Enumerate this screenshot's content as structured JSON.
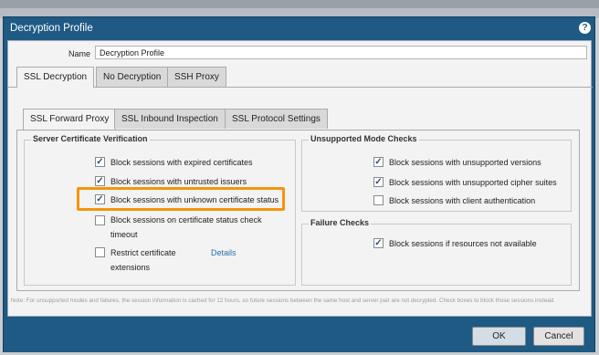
{
  "dialog": {
    "title": "Decryption Profile",
    "help_icon": "question-circle-icon"
  },
  "name": {
    "label": "Name",
    "value": "Decryption Profile"
  },
  "tabs": [
    {
      "label": "SSL Decryption",
      "active": true
    },
    {
      "label": "No Decryption",
      "active": false
    },
    {
      "label": "SSH Proxy",
      "active": false
    }
  ],
  "subtabs": [
    {
      "label": "SSL Forward Proxy",
      "active": true
    },
    {
      "label": "SSL Inbound Inspection",
      "active": false
    },
    {
      "label": "SSL Protocol Settings",
      "active": false
    }
  ],
  "server_cert": {
    "title": "Server Certificate Verification",
    "items": [
      {
        "label": "Block sessions with expired certificates",
        "checked": true
      },
      {
        "label": "Block sessions with untrusted issuers",
        "checked": true
      },
      {
        "label": "Block sessions with unknown certificate status",
        "checked": true
      },
      {
        "label": "Block sessions on certificate status check",
        "label2": "timeout",
        "checked": false
      },
      {
        "label": "Restrict certificate",
        "label2": "extensions",
        "checked": false
      }
    ],
    "details_link": "Details"
  },
  "unsupported": {
    "title": "Unsupported Mode Checks",
    "items": [
      {
        "label": "Block sessions with unsupported versions",
        "checked": true
      },
      {
        "label": "Block sessions with unsupported cipher suites",
        "checked": true
      },
      {
        "label": "Block sessions with client authentication",
        "checked": false
      }
    ]
  },
  "failure": {
    "title": "Failure Checks",
    "items": [
      {
        "label": "Block sessions if resources not available",
        "checked": true
      }
    ]
  },
  "note": "Note: For unsupported modes and failures, the session information is cached for 12 hours, so future sessions between the same host and server pair are not decrypted. Check boxes to block those sessions instead.",
  "buttons": {
    "ok": "OK",
    "cancel": "Cancel"
  },
  "colors": {
    "titlebar": "#1e5a84",
    "highlight": "#f5940b",
    "link": "#2a6ea8"
  }
}
